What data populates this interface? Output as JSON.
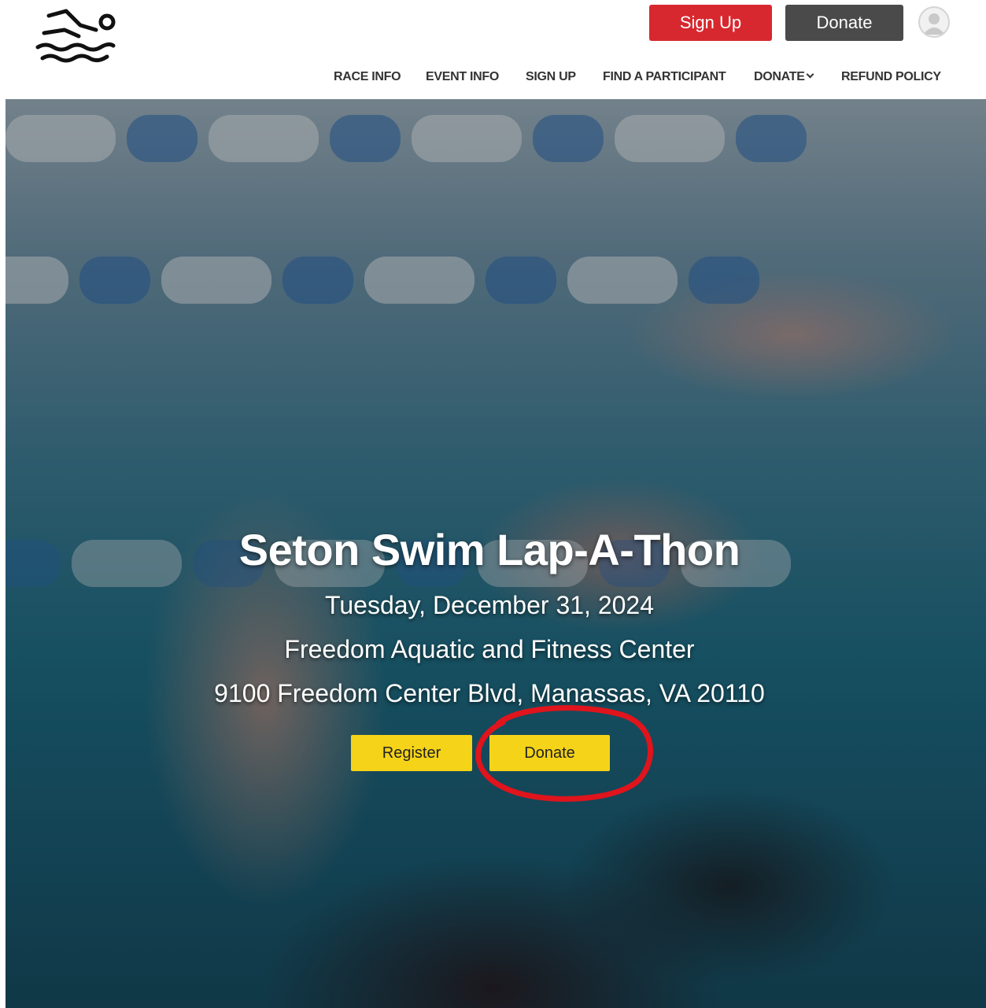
{
  "header": {
    "logo_icon": "swimmer-icon",
    "signup_label": "Sign Up",
    "donate_label": "Donate",
    "avatar_icon": "user-avatar-icon",
    "colors": {
      "signup": "#d7282f",
      "donate": "#4a4a4a"
    }
  },
  "nav": {
    "items": [
      {
        "label": "RACE INFO"
      },
      {
        "label": "EVENT INFO"
      },
      {
        "label": "SIGN UP"
      },
      {
        "label": "FIND A PARTICIPANT"
      },
      {
        "label": "DONATE",
        "icon": "chevron-down-icon"
      },
      {
        "label": "REFUND POLICY"
      }
    ]
  },
  "hero": {
    "title": "Seton Swim Lap-A-Thon",
    "date": "Tuesday, December 31, 2024",
    "venue": "Freedom Aquatic and Fitness Center",
    "address": "9100 Freedom Center Blvd, Manassas, VA 20110",
    "register_label": "Register",
    "donate_label": "Donate",
    "button_color": "#f5d318",
    "annotation_color": "#e0141c"
  }
}
